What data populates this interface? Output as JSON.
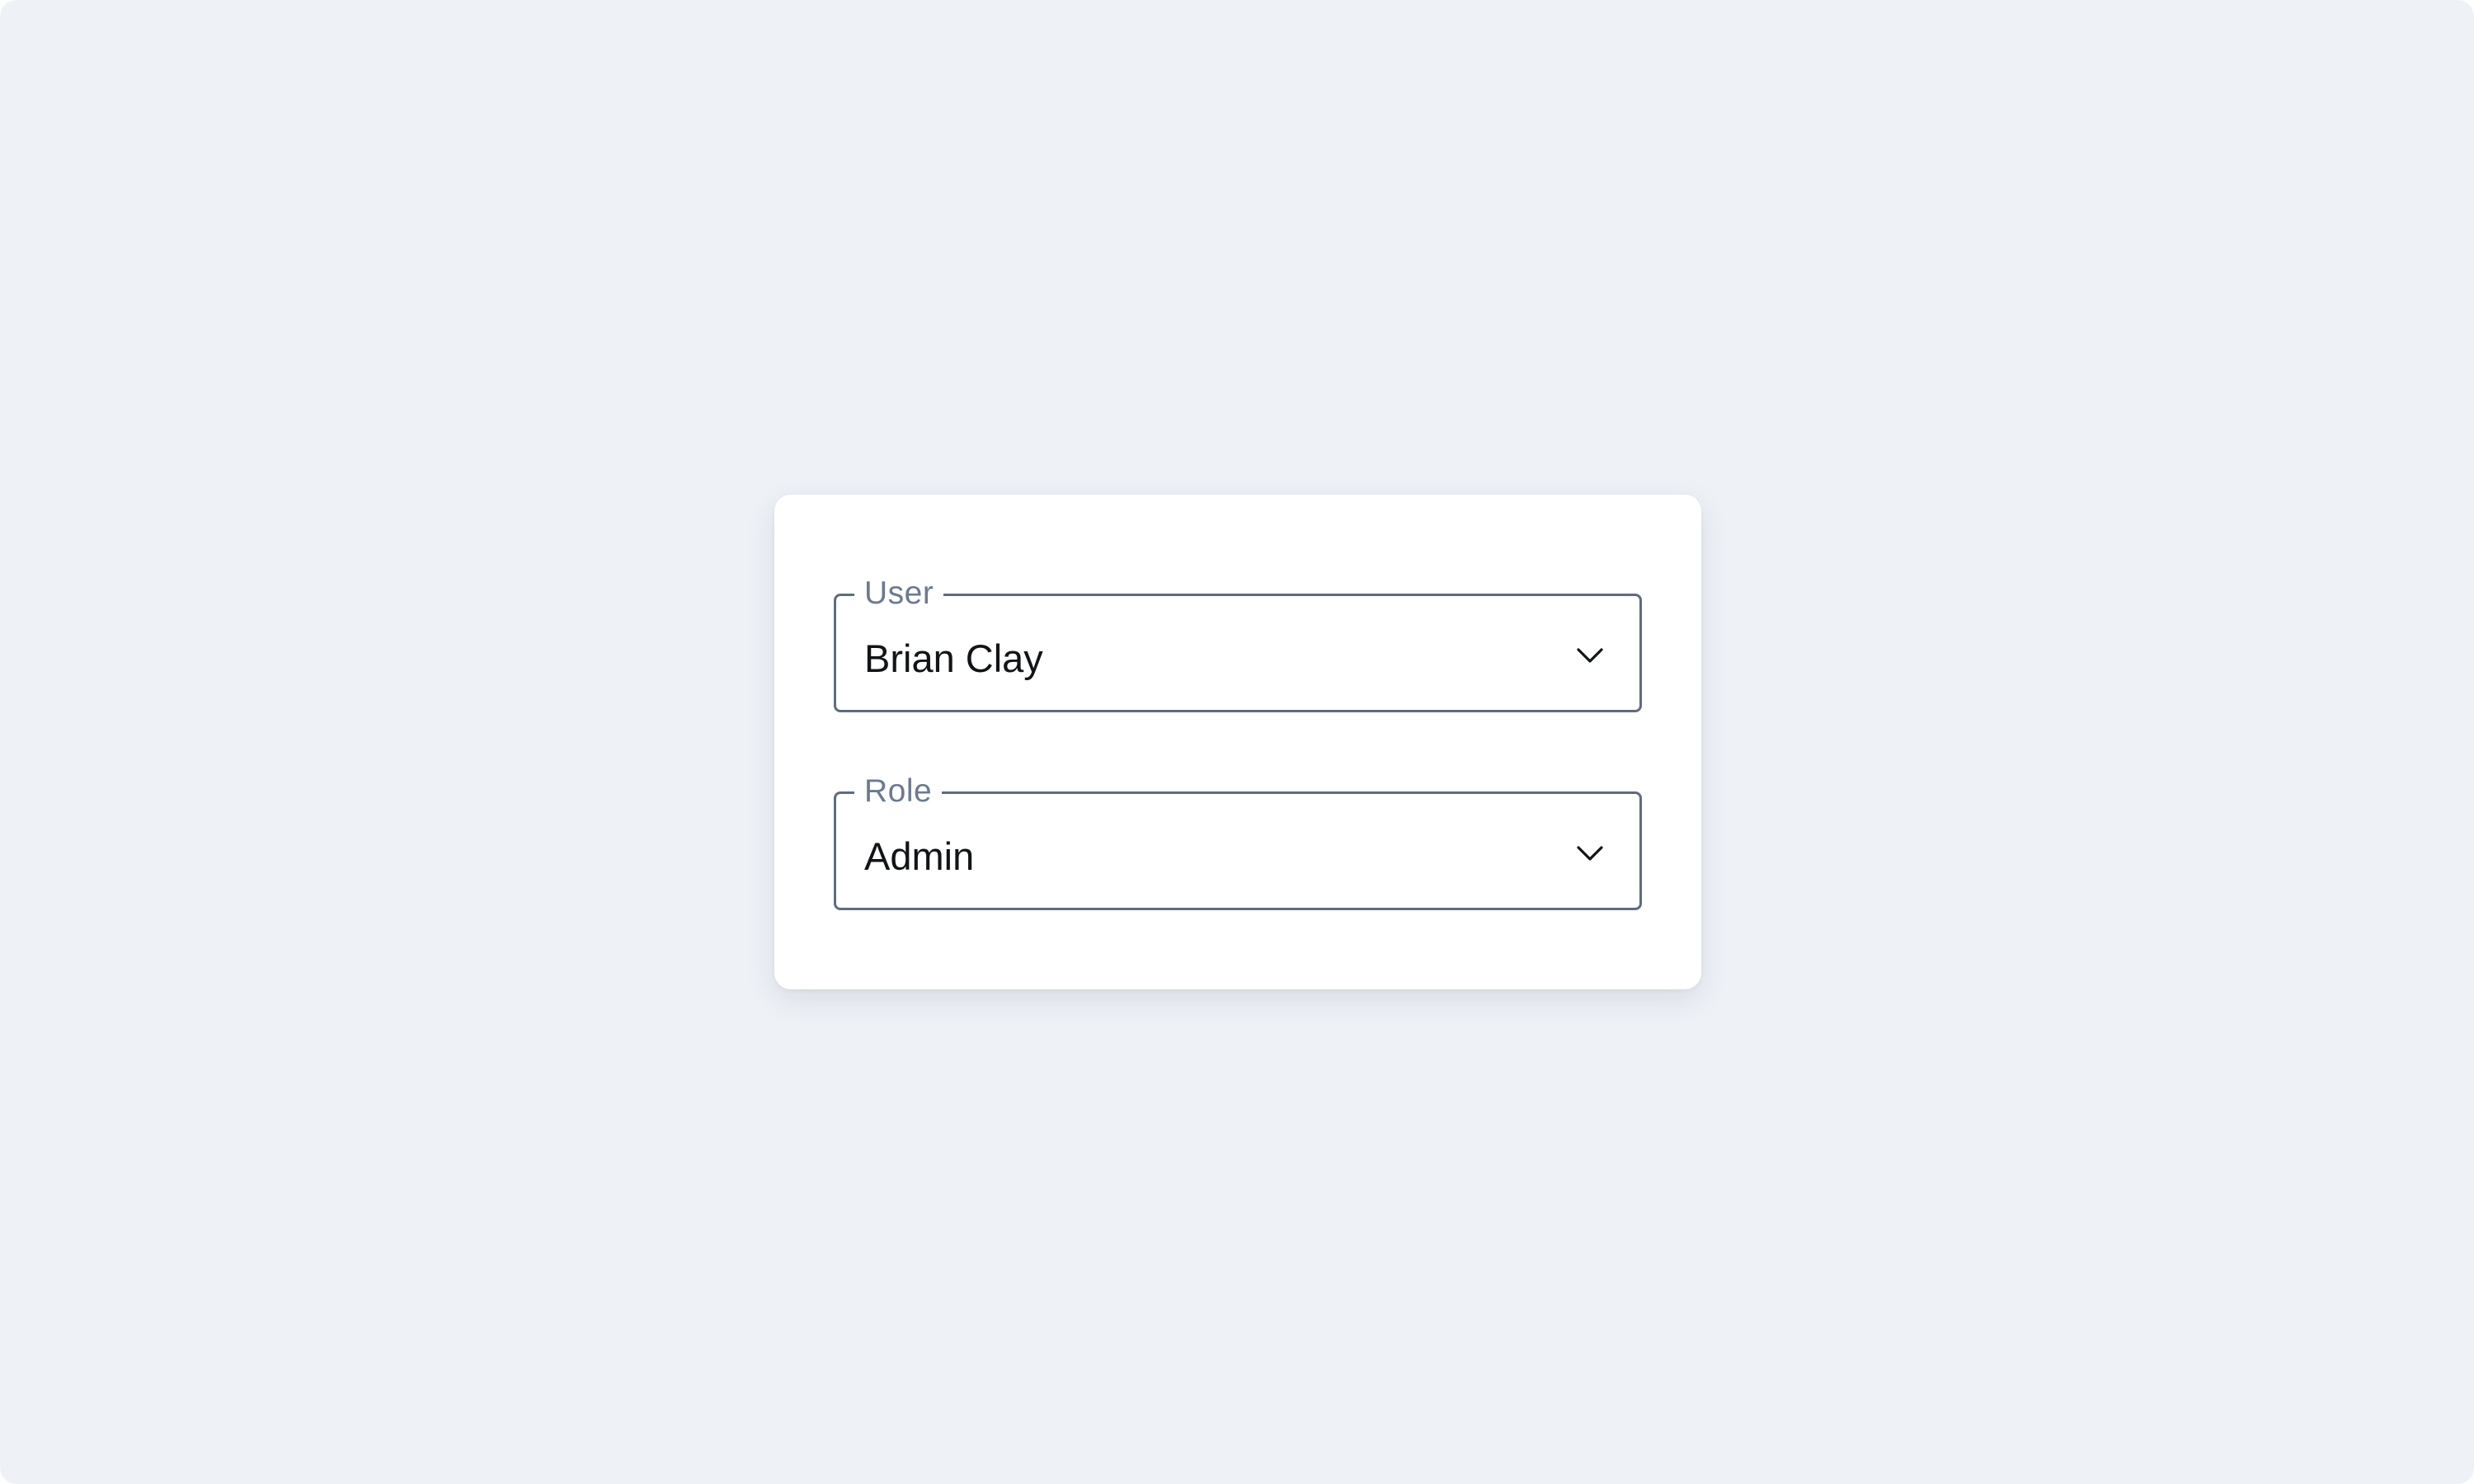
{
  "form": {
    "user": {
      "label": "User",
      "value": "Brian Clay",
      "icon": "chevron-down-icon"
    },
    "role": {
      "label": "Role",
      "value": "Admin",
      "icon": "chevron-down-icon"
    }
  },
  "colors": {
    "page_background": "#eef1f6",
    "card_background": "#ffffff",
    "field_border": "#5f6c7d",
    "label_text": "#6c7a8f",
    "value_text": "#121418"
  }
}
